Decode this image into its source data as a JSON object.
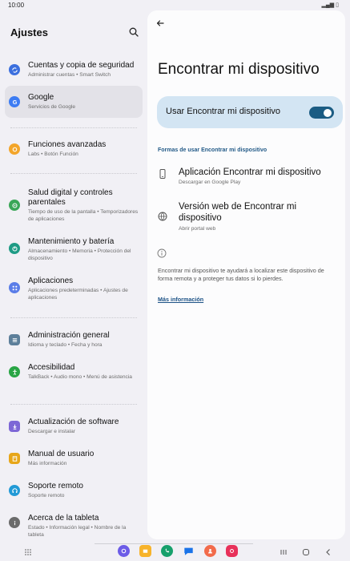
{
  "status_bar": {
    "time": "10:00",
    "signal": "▂▄▆ ▯"
  },
  "settings": {
    "title": "Ajustes",
    "items": [
      {
        "title": "Cuentas y copia de seguridad",
        "sub": "Administrar cuentas • Smart Switch",
        "icon": "sync-icon",
        "color": "#3b6fde"
      },
      {
        "title": "Google",
        "sub": "Servicios de Google",
        "icon": "google-icon",
        "color": "#3d7cf3"
      },
      {
        "title": "Funciones avanzadas",
        "sub": "Labs • Botón Función",
        "icon": "star-gear-icon",
        "color": "#f3a52a"
      },
      {
        "title": "Salud digital y controles parentales",
        "sub": "Tiempo de uso de la pantalla • Temporizadores de aplicaciones",
        "icon": "digital-wellbeing-icon",
        "color": "#3aa657"
      },
      {
        "title": "Mantenimiento y batería",
        "sub": "Almacenamiento • Memoria • Protección del dispositivo",
        "icon": "battery-care-icon",
        "color": "#1e9b85"
      },
      {
        "title": "Aplicaciones",
        "sub": "Aplicaciones predeterminadas • Ajustes de aplicaciones",
        "icon": "apps-grid-icon",
        "color": "#5a7de8"
      },
      {
        "title": "Administración general",
        "sub": "Idioma y teclado • Fecha y hora",
        "icon": "sliders-icon",
        "color": "#5d7f9a"
      },
      {
        "title": "Accesibilidad",
        "sub": "TalkBack • Audio mono • Menú de asistencia",
        "icon": "accessibility-icon",
        "color": "#29a545"
      },
      {
        "title": "Actualización de software",
        "sub": "Descargar e instalar",
        "icon": "software-update-icon",
        "color": "#7d67d6"
      },
      {
        "title": "Manual de usuario",
        "sub": "Más información",
        "icon": "manual-icon",
        "color": "#e7a619"
      },
      {
        "title": "Soporte remoto",
        "sub": "Soporte remoto",
        "icon": "headset-icon",
        "color": "#229ad6"
      },
      {
        "title": "Acerca de la tableta",
        "sub": "Estado • Información legal • Nombre de la tableta",
        "icon": "info-circle-icon",
        "color": "#6b6b6b"
      }
    ]
  },
  "detail": {
    "title": "Encontrar mi dispositivo",
    "toggle_label": "Usar Encontrar mi dispositivo",
    "toggle_on": true,
    "section_header": "Formas de usar Encontrar mi dispositivo",
    "options": [
      {
        "title": "Aplicación Encontrar mi dispositivo",
        "sub": "Descargar en Google Play",
        "icon": "phone-icon"
      },
      {
        "title": "Versión web de Encontrar mi dispositivo",
        "sub": "Abrir portal web",
        "icon": "globe-icon"
      }
    ],
    "info_text": "Encontrar mi dispositivo te ayudará a localizar este dispositivo de forma remota y a proteger tus datos si lo pierdes.",
    "more_link": "Más información"
  },
  "colors": {
    "accent": "#1b5c83",
    "toggle_card": "#d3e5f3",
    "link": "#1c5286"
  },
  "dock": [
    {
      "name": "bixby-icon",
      "color": "#6c5ce7"
    },
    {
      "name": "folder-icon",
      "color": "#f7b32b"
    },
    {
      "name": "phone-call-icon",
      "color": "#17a06c"
    },
    {
      "name": "messages-icon",
      "color": "#1a73e8"
    },
    {
      "name": "contacts-icon",
      "color": "#f26b4b"
    },
    {
      "name": "camera-icon",
      "color": "#e8315a"
    }
  ]
}
